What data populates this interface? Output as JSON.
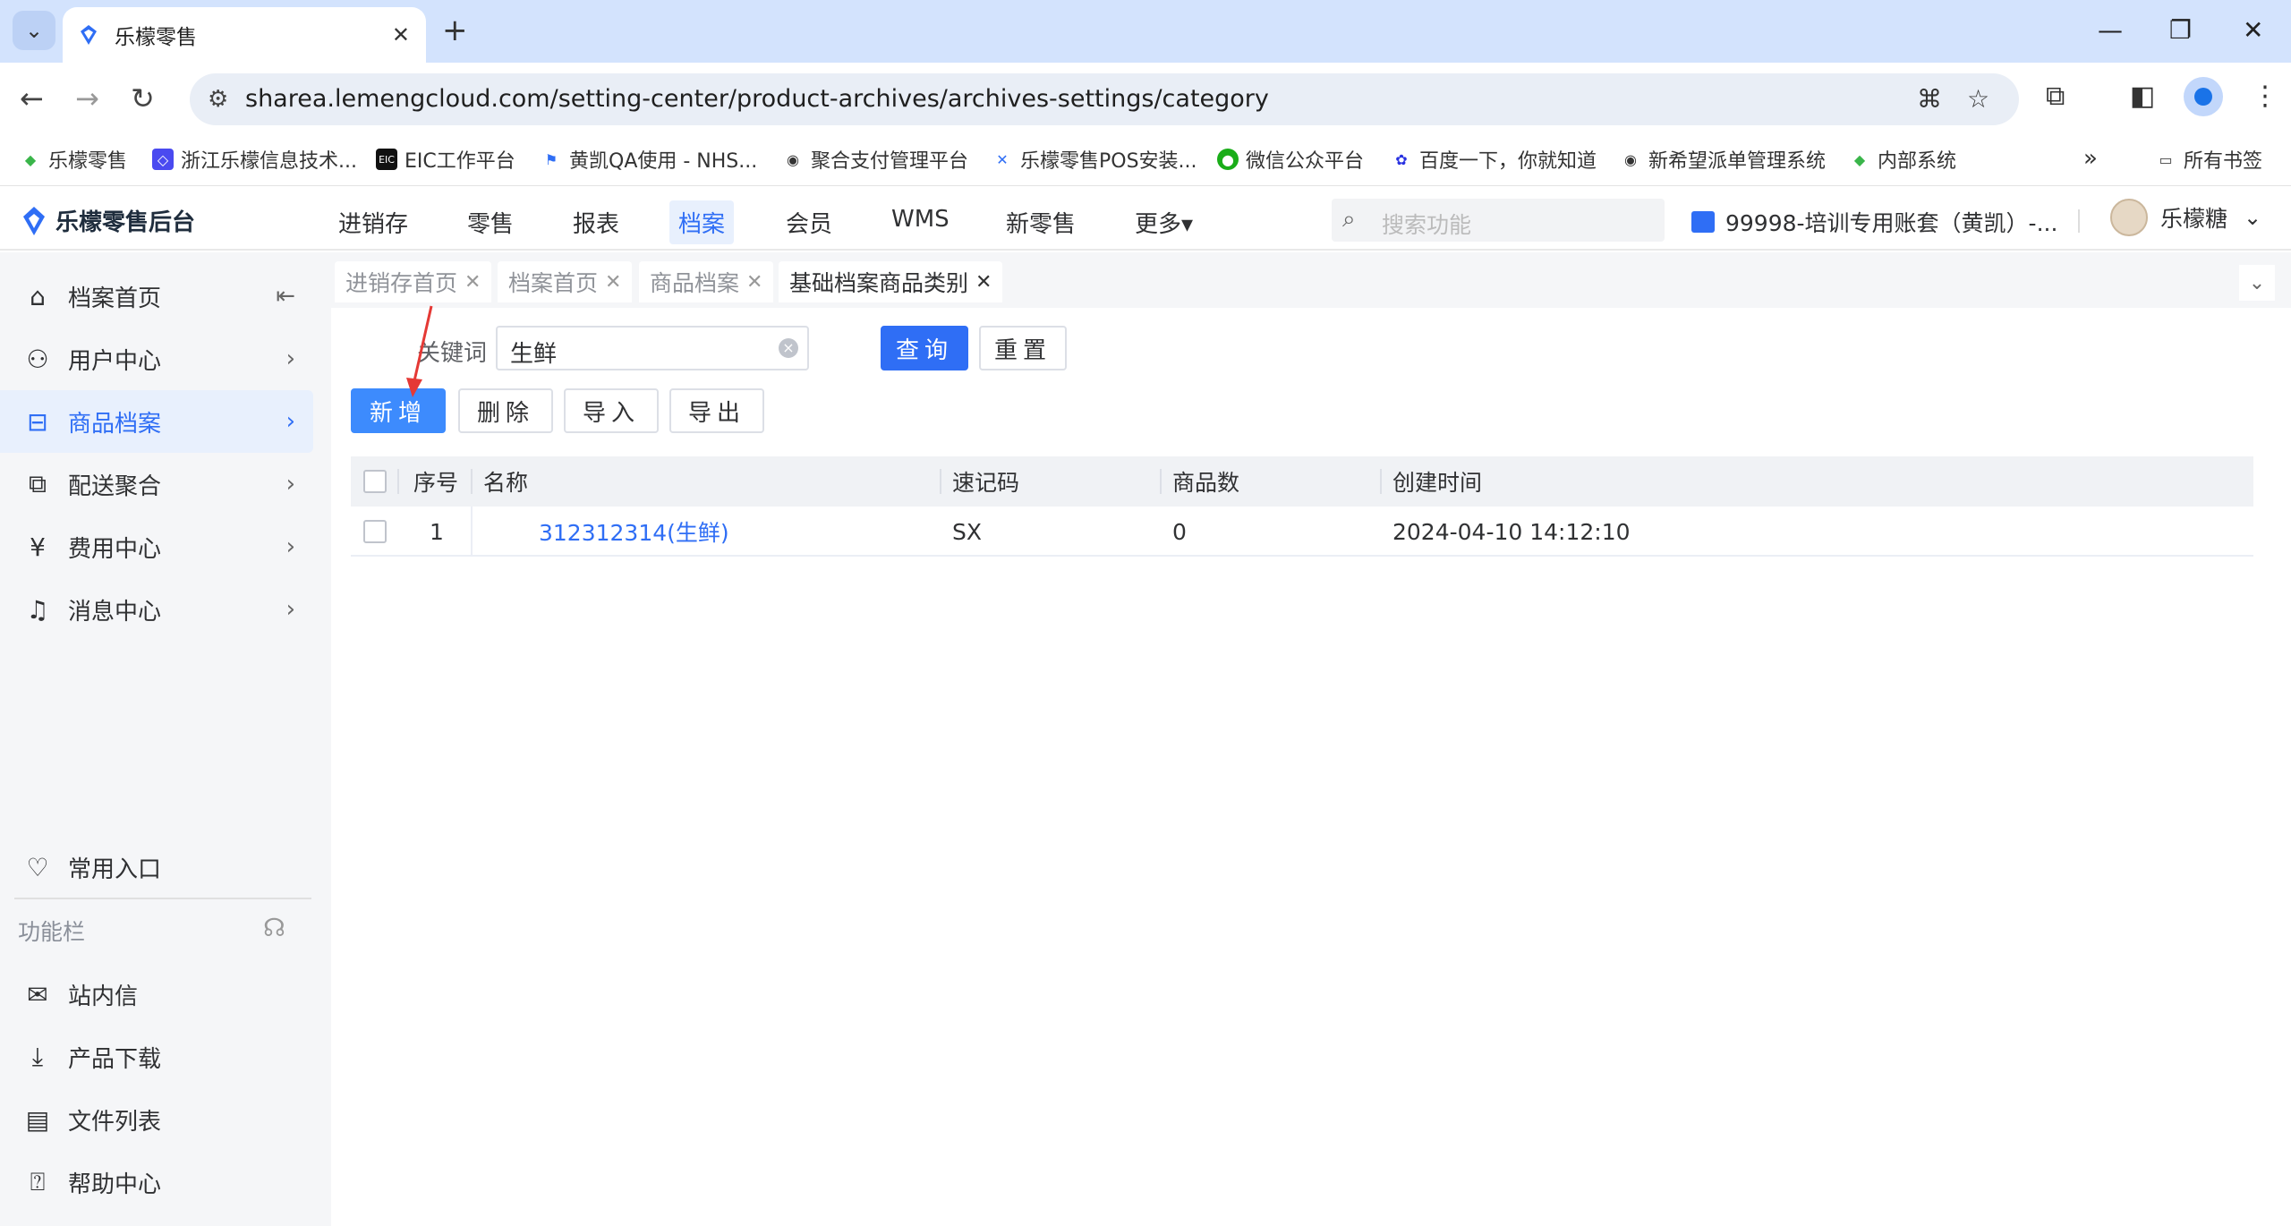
{
  "browser": {
    "tab_title": "乐檬零售",
    "url": "sharea.lemengcloud.com/setting-center/product-archives/archives-settings/category",
    "new_tab": "+",
    "bookmarks": [
      "乐檬零售",
      "浙江乐檬信息技术...",
      "EIC工作平台",
      "黄凯QA使用 - NHS...",
      "聚合支付管理平台",
      "乐檬零售POS安装...",
      "微信公众平台",
      "百度一下，你就知道",
      "新希望派单管理系统",
      "内部系统"
    ],
    "bookmarks_more": "»",
    "all_bookmarks": "所有书签"
  },
  "app": {
    "logo": "乐檬零售后台",
    "nav": [
      "进销存",
      "零售",
      "报表",
      "档案",
      "会员",
      "WMS",
      "新零售",
      "更多▾"
    ],
    "active_nav": "档案",
    "search_placeholder": "搜索功能",
    "account": "99998-培训专用账套（黄凯）-...",
    "user": "乐檬糖"
  },
  "sidebar": {
    "items": [
      {
        "label": "档案首页",
        "icon": "home-icon"
      },
      {
        "label": "用户中心",
        "icon": "user-icon"
      },
      {
        "label": "商品档案",
        "icon": "product-icon",
        "active": true
      },
      {
        "label": "配送聚合",
        "icon": "delivery-icon"
      },
      {
        "label": "费用中心",
        "icon": "yen-icon"
      },
      {
        "label": "消息中心",
        "icon": "bell-icon"
      }
    ],
    "favorites": "常用入口",
    "group_label": "功能栏",
    "tools": [
      "站内信",
      "产品下载",
      "文件列表",
      "帮助中心"
    ]
  },
  "page_tabs": [
    {
      "label": "进销存首页",
      "active": false
    },
    {
      "label": "档案首页",
      "active": false
    },
    {
      "label": "商品档案",
      "active": false
    },
    {
      "label": "基础档案商品类别",
      "active": true
    }
  ],
  "filter": {
    "keyword_label": "关键词",
    "keyword_value": "生鲜",
    "query_button": "查询",
    "reset_button": "重置"
  },
  "toolbar": {
    "add": "新增",
    "delete": "删除",
    "import": "导入",
    "export": "导出"
  },
  "table": {
    "headers": [
      "序号",
      "名称",
      "速记码",
      "商品数",
      "创建时间"
    ],
    "rows": [
      {
        "index": "1",
        "name": "312312314(生鲜)",
        "code": "SX",
        "count": "0",
        "created": "2024-04-10 14:12:10"
      }
    ]
  },
  "colors": {
    "primary": "#2f6ef5",
    "sidebar_bg": "#f5f6f8",
    "browser_frame": "#d3e3fd"
  }
}
